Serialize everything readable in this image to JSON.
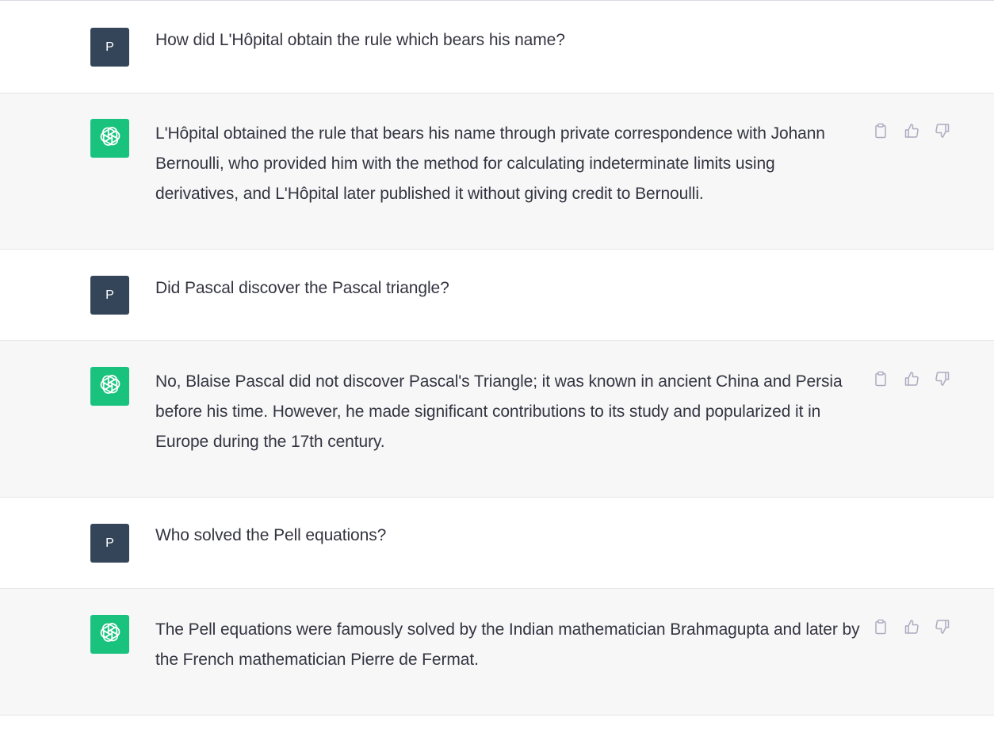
{
  "user": {
    "avatar_letter": "P"
  },
  "messages": [
    {
      "role": "user",
      "text": "How did L'Hôpital obtain the rule which bears his name?"
    },
    {
      "role": "assistant",
      "text": "L'Hôpital obtained the rule that bears his name through private correspondence with Johann Bernoulli, who provided him with the method for calculating indeterminate limits using derivatives, and L'Hôpital later published it without giving credit to Bernoulli."
    },
    {
      "role": "user",
      "text": "Did Pascal discover the Pascal triangle?"
    },
    {
      "role": "assistant",
      "text": "No, Blaise Pascal did not discover Pascal's Triangle; it was known in ancient China and Persia before his time. However, he made significant contributions to its study and popularized it in Europe during the 17th century."
    },
    {
      "role": "user",
      "text": "Who solved the Pell equations?"
    },
    {
      "role": "assistant",
      "text": "The Pell equations were famously solved by the Indian mathematician Brahmagupta and later by the French mathematician Pierre de Fermat."
    }
  ],
  "icons": {
    "assistant_avatar": "openai-logo-icon",
    "copy": "clipboard-icon",
    "like": "thumbs-up-icon",
    "dislike": "thumbs-down-icon"
  },
  "colors": {
    "user_avatar_bg": "#344559",
    "assistant_avatar_bg": "#19c37d",
    "assistant_row_bg": "#f7f7f8",
    "text": "#343541"
  }
}
